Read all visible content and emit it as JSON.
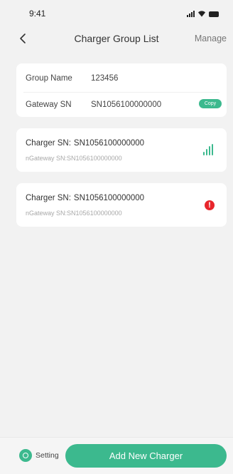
{
  "status_bar": {
    "time": "9:41"
  },
  "header": {
    "title": "Charger Group List",
    "manage_label": "Manage"
  },
  "group_info": {
    "group_name_label": "Group Name",
    "group_name_value": "123456",
    "gateway_label": "Gateway SN",
    "gateway_value": "SN1056100000000",
    "copy_label": "Copy"
  },
  "chargers": [
    {
      "charger_label": "Charger SN",
      "separator": ":",
      "charger_sn": "SN1056100000000",
      "gateway_label": "nGateway SN",
      "gateway_separator": ":",
      "gateway_sn": "SN1056100000000",
      "status_icon": "signal-bars-icon"
    },
    {
      "charger_label": "Charger SN",
      "separator": ":",
      "charger_sn": "SN1056100000000",
      "gateway_label": "nGateway SN",
      "gateway_separator": ":",
      "gateway_sn": "SN1056100000000",
      "status_icon": "alert-icon"
    }
  ],
  "footer": {
    "setting_label": "Setting",
    "add_button_label": "Add New Charger"
  },
  "colors": {
    "accent": "#3cb98e",
    "alert": "#e8262c",
    "background": "#f2f2f2"
  }
}
